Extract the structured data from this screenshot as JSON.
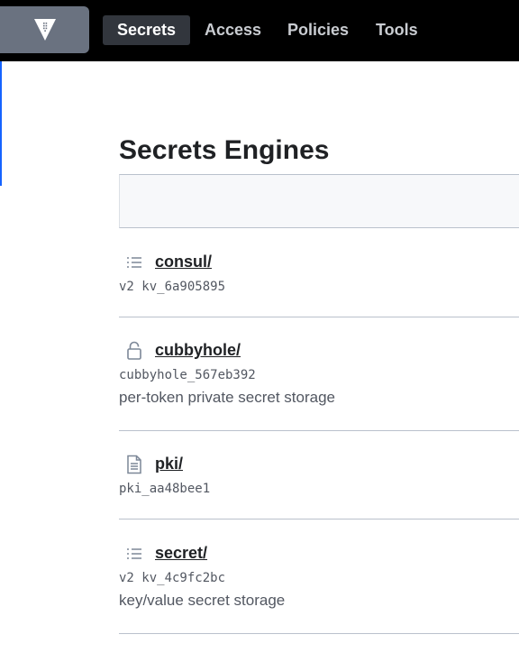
{
  "nav": {
    "logo_icon": "vault-logo-icon",
    "items": [
      {
        "label": "Secrets",
        "active": true
      },
      {
        "label": "Access",
        "active": false
      },
      {
        "label": "Policies",
        "active": false
      },
      {
        "label": "Tools",
        "active": false
      }
    ]
  },
  "page": {
    "title": "Secrets Engines"
  },
  "engines": [
    {
      "path": "consul/",
      "icon": "list-icon",
      "accessor": "v2 kv_6a905895",
      "description": ""
    },
    {
      "path": "cubbyhole/",
      "icon": "lock-icon",
      "accessor": "cubbyhole_567eb392",
      "description": "per-token private secret storage"
    },
    {
      "path": "pki/",
      "icon": "document-icon",
      "accessor": "pki_aa48bee1",
      "description": ""
    },
    {
      "path": "secret/",
      "icon": "list-icon",
      "accessor": "v2 kv_4c9fc2bc",
      "description": "key/value secret storage"
    }
  ],
  "colors": {
    "topbar": "#000000",
    "logo_bg": "#6a7280",
    "active_nav_bg": "#32363d",
    "accent_edge": "#1563ff",
    "divider": "#bac1cc",
    "muted_text": "#525761"
  }
}
